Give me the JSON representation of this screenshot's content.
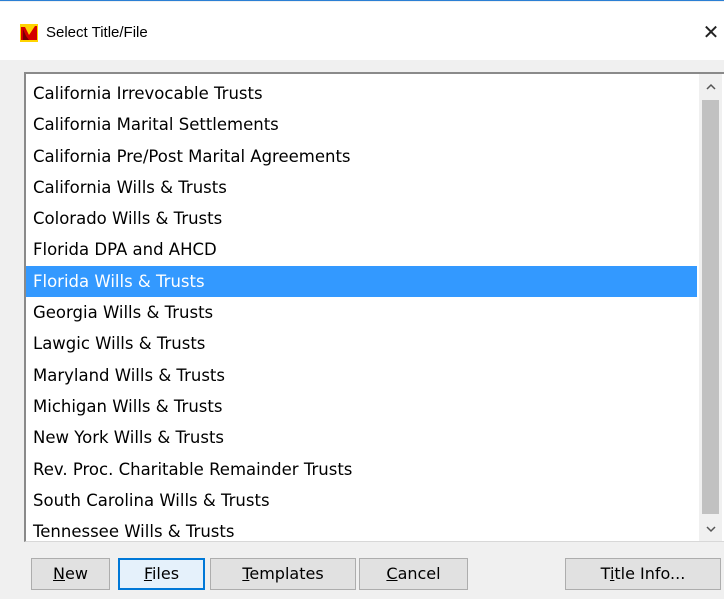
{
  "window": {
    "title": "Select Title/File",
    "close_glyph": "✕",
    "app_icon": "app-logo-icon"
  },
  "list": {
    "selected_index": 6,
    "items": [
      "California Irrevocable Trusts",
      "California Marital Settlements",
      "California Pre/Post Marital Agreements",
      "California Wills & Trusts",
      "Colorado Wills & Trusts",
      "Florida DPA and AHCD",
      "Florida Wills & Trusts",
      "Georgia Wills & Trusts",
      "Lawgic Wills & Trusts",
      "Maryland Wills & Trusts",
      "Michigan Wills & Trusts",
      "New York Wills & Trusts",
      "Rev. Proc. Charitable Remainder Trusts",
      "South Carolina Wills & Trusts",
      "Tennessee Wills & Trusts"
    ]
  },
  "scrollbar": {
    "up_glyph": "^",
    "down_glyph": "v"
  },
  "buttons": {
    "new": {
      "accel": "N",
      "rest": "ew"
    },
    "files": {
      "accel": "F",
      "rest": "iles"
    },
    "templates": {
      "accel": "T",
      "rest": "emplates"
    },
    "cancel": {
      "accel": "C",
      "rest": "ancel"
    },
    "title_info": {
      "pre": "T",
      "accel": "i",
      "rest": "tle Info..."
    }
  },
  "colors": {
    "selection": "#3399ff",
    "default_button_border": "#0078d7"
  }
}
